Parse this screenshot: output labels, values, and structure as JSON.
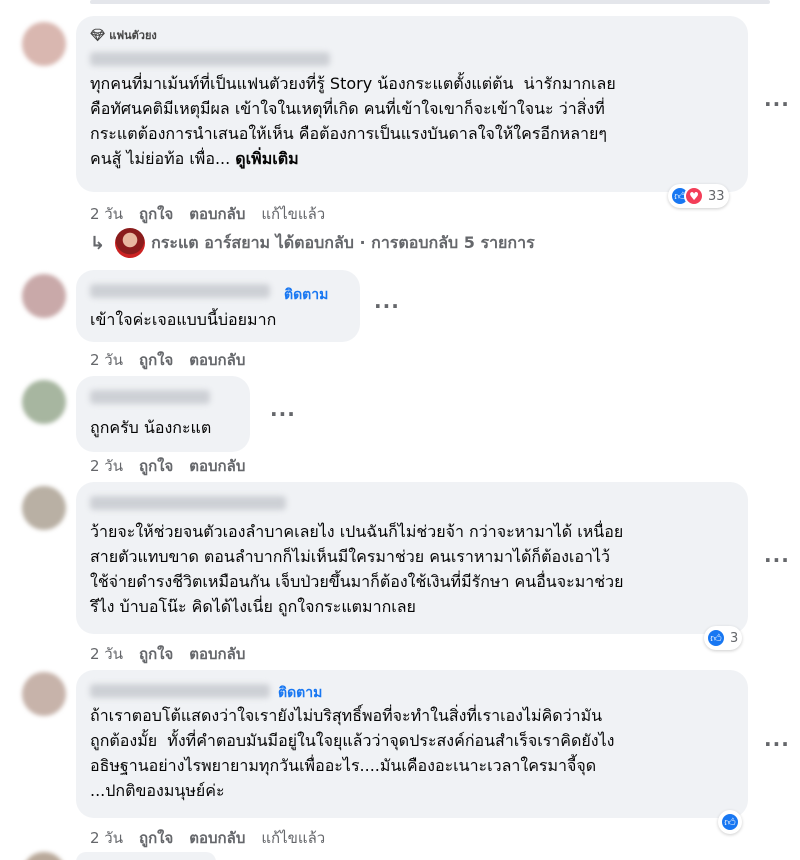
{
  "comments": [
    {
      "badge": "แฟนตัวยง",
      "text": "ทุกคนที่มาเม้นท์ที่เป็นแฟนตัวยงที่รู้ Story น้องกระแตตั้งแต่ต้น  น่ารักมากเลย\nคือทัศนคติมีเหตุมีผล เข้าใจในเหตุที่เกิด คนที่เข้าใจเขาก็จะเข้าใจนะ ว่าสิ่งที่\nกระแตต้องการนำเสนอให้เห็น คือต้องการเป็นแรงบันดาลใจให้ใครอีกหลายๆ\nคนสู้ ไม่ย่อท้อ เพื่อ... ",
      "see_more": "ดูเพิ่มเติม",
      "time": "2 วัน",
      "like": "ถูกใจ",
      "reply": "ตอบกลับ",
      "edited": "แก้ไขแล้ว",
      "reaction_count": "33"
    },
    {
      "follow": "ติดตาม",
      "text": "เข้าใจค่ะเจอแบบนี้บ่อยมาก",
      "time": "2 วัน",
      "like": "ถูกใจ",
      "reply": "ตอบกลับ"
    },
    {
      "text": "ถูกครับ น้องกะแต",
      "time": "2 วัน",
      "like": "ถูกใจ",
      "reply": "ตอบกลับ"
    },
    {
      "text": "ว้ายจะให้ช่วยจนตัวเองลำบาคเลยไง เปนฉันก็ไม่ช่วยจ้า กว่าจะหามาได้ เหนื่อย\nสายตัวแทบขาด ตอนลำบากก็ไม่เห็นมีใครมาช่วย คนเราหามาได้ก็ต้องเอาไว้\nใช้จ่ายดำรงชีวิตเหมือนกัน เจ็บป่วยขึ้นมาก็ต้องใช้เงินที่มีรักษา คนอื่นจะมาช่วย\nรึไง บ้าบอโน๊ะ คิดได้ไงเนี่ย ถูกใจกระแตมากเลย",
      "time": "2 วัน",
      "like": "ถูกใจ",
      "reply": "ตอบกลับ",
      "reaction_count": "3"
    },
    {
      "follow": "ติดตาม",
      "text": "ถ้าเราตอบโต้แสดงว่าใจเรายังไม่บริสุทธิ์พอที่จะทำในสิ่งที่เราเองไม่คิดว่ามัน\nถูกต้องมั้ย  ทั้งที่คำตอบมันมีอยู่ในใจยุแล้วว่าจุดประสงค์ก่อนสำเร็จเราคิดยังไง\nอธิษฐานอย่างไรพยายามทุกวันเพื่ออะไร....มันเคืองอะเนาะเวลาใครมาจี้จุด\n...ปกติของมนุษย์ค่ะ",
      "time": "2 วัน",
      "like": "ถูกใจ",
      "reply": "ตอบกลับ",
      "edited": "แก้ไขแล้ว"
    }
  ],
  "reply_thread": {
    "text": "กระแต อาร์สยาม ได้ตอบกลับ · การตอบกลับ 5 รายการ"
  },
  "more_label": "···",
  "colors": {
    "link": "#1877f2",
    "bubble": "#f0f2f5",
    "meta": "#65676b"
  },
  "icons": [
    "diamond-badge-icon",
    "like-reaction-icon",
    "love-reaction-icon",
    "reply-arrow-icon",
    "more-dots-icon"
  ]
}
